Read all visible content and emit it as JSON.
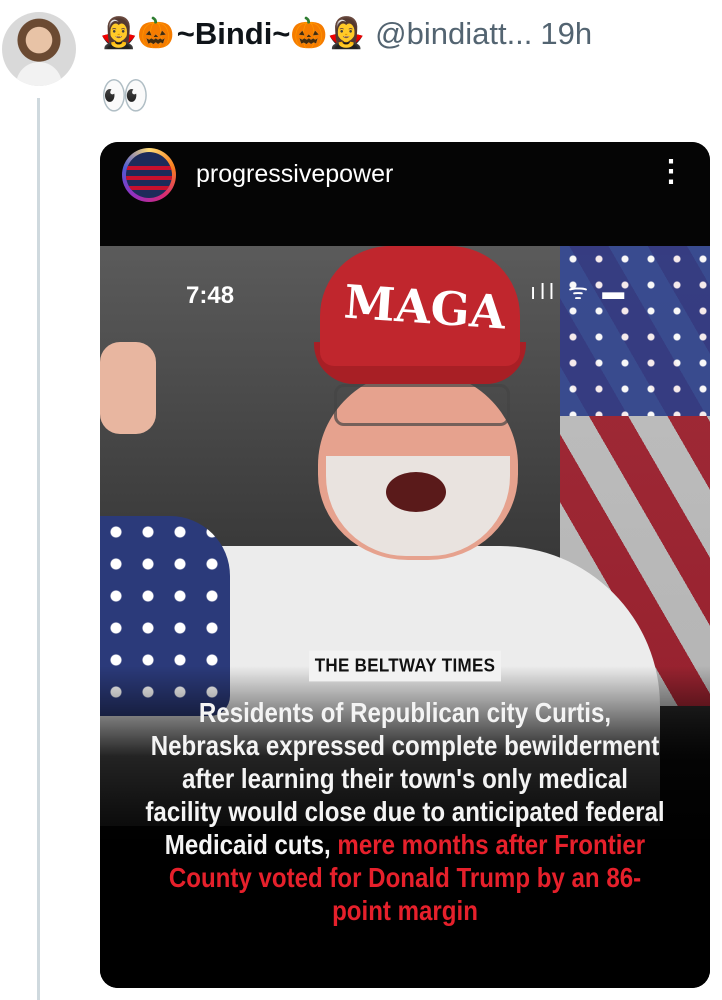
{
  "tweet": {
    "name_prefix_emoji": "🧛‍♀️🎃",
    "display_name": "~Bindi~",
    "name_suffix_emoji": "🎃🧛‍♀️",
    "handle": "@bindiatt...",
    "time": "19h",
    "body_emoji": "👀"
  },
  "embedded_post": {
    "username": "progressivepower",
    "menu_glyph": "⋮",
    "phone_status_time": "7:48",
    "phone_status_icons": "ıll ᯤ ▬",
    "cap_text": "MAGA",
    "publication": "THE BELTWAY TIMES",
    "headline_white": "Residents of Republican city Curtis, Nebraska expressed complete bewilderment after learning their town's only medical facility would close due to anticipated federal Medicaid cuts,",
    "headline_red": "mere months after Frontier County voted for Donald Trump by an 86-point margin"
  },
  "colors": {
    "accent_red": "#e6202b",
    "text_primary": "#0f1419",
    "text_secondary": "#536471",
    "thread_line": "#cfd9de"
  },
  "icons": {
    "avatar": "profile-photo",
    "ig_avatar": "us-flag-circle",
    "menu": "more-vertical-icon"
  }
}
